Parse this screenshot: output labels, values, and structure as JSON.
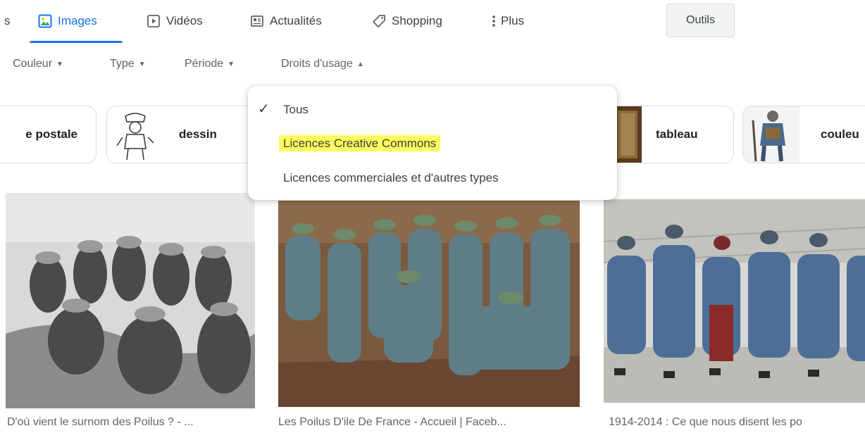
{
  "tabs": [
    {
      "label": "s",
      "icon": "none"
    },
    {
      "label": "Images",
      "icon": "image-icon",
      "active": true
    },
    {
      "label": "Vidéos",
      "icon": "play-icon"
    },
    {
      "label": "Actualités",
      "icon": "news-icon"
    },
    {
      "label": "Shopping",
      "icon": "tag-icon"
    },
    {
      "label": "Plus",
      "icon": "more-vert-icon"
    }
  ],
  "tools_label": "Outils",
  "filters": [
    {
      "label": "Couleur",
      "icon": "caret-down-icon"
    },
    {
      "label": "Type",
      "icon": "caret-down-icon"
    },
    {
      "label": "Période",
      "icon": "caret-down-icon"
    },
    {
      "label": "Droits d'usage",
      "icon": "caret-up-icon"
    }
  ],
  "chips": [
    {
      "label": "e postale"
    },
    {
      "label": "dessin"
    },
    {
      "label": "tableau"
    },
    {
      "label": "couleu"
    }
  ],
  "usage_rights_menu": {
    "items": [
      {
        "label": "Tous",
        "selected": true
      },
      {
        "label": "Licences Creative Commons",
        "highlighted": true,
        "highlight_color": "#fdfc5c"
      },
      {
        "label": "Licences commerciales et d'autres types"
      }
    ]
  },
  "results": [
    {
      "caption": "D'où vient le surnom des Poilus ? - ..."
    },
    {
      "caption": "Les Poilus D'ile De France - Accueil | Faceb..."
    },
    {
      "caption": "1914-2014 : Ce que nous disent les po"
    }
  ],
  "colors": {
    "accent": "#1a73e8",
    "highlight": "#fdfc5c"
  }
}
